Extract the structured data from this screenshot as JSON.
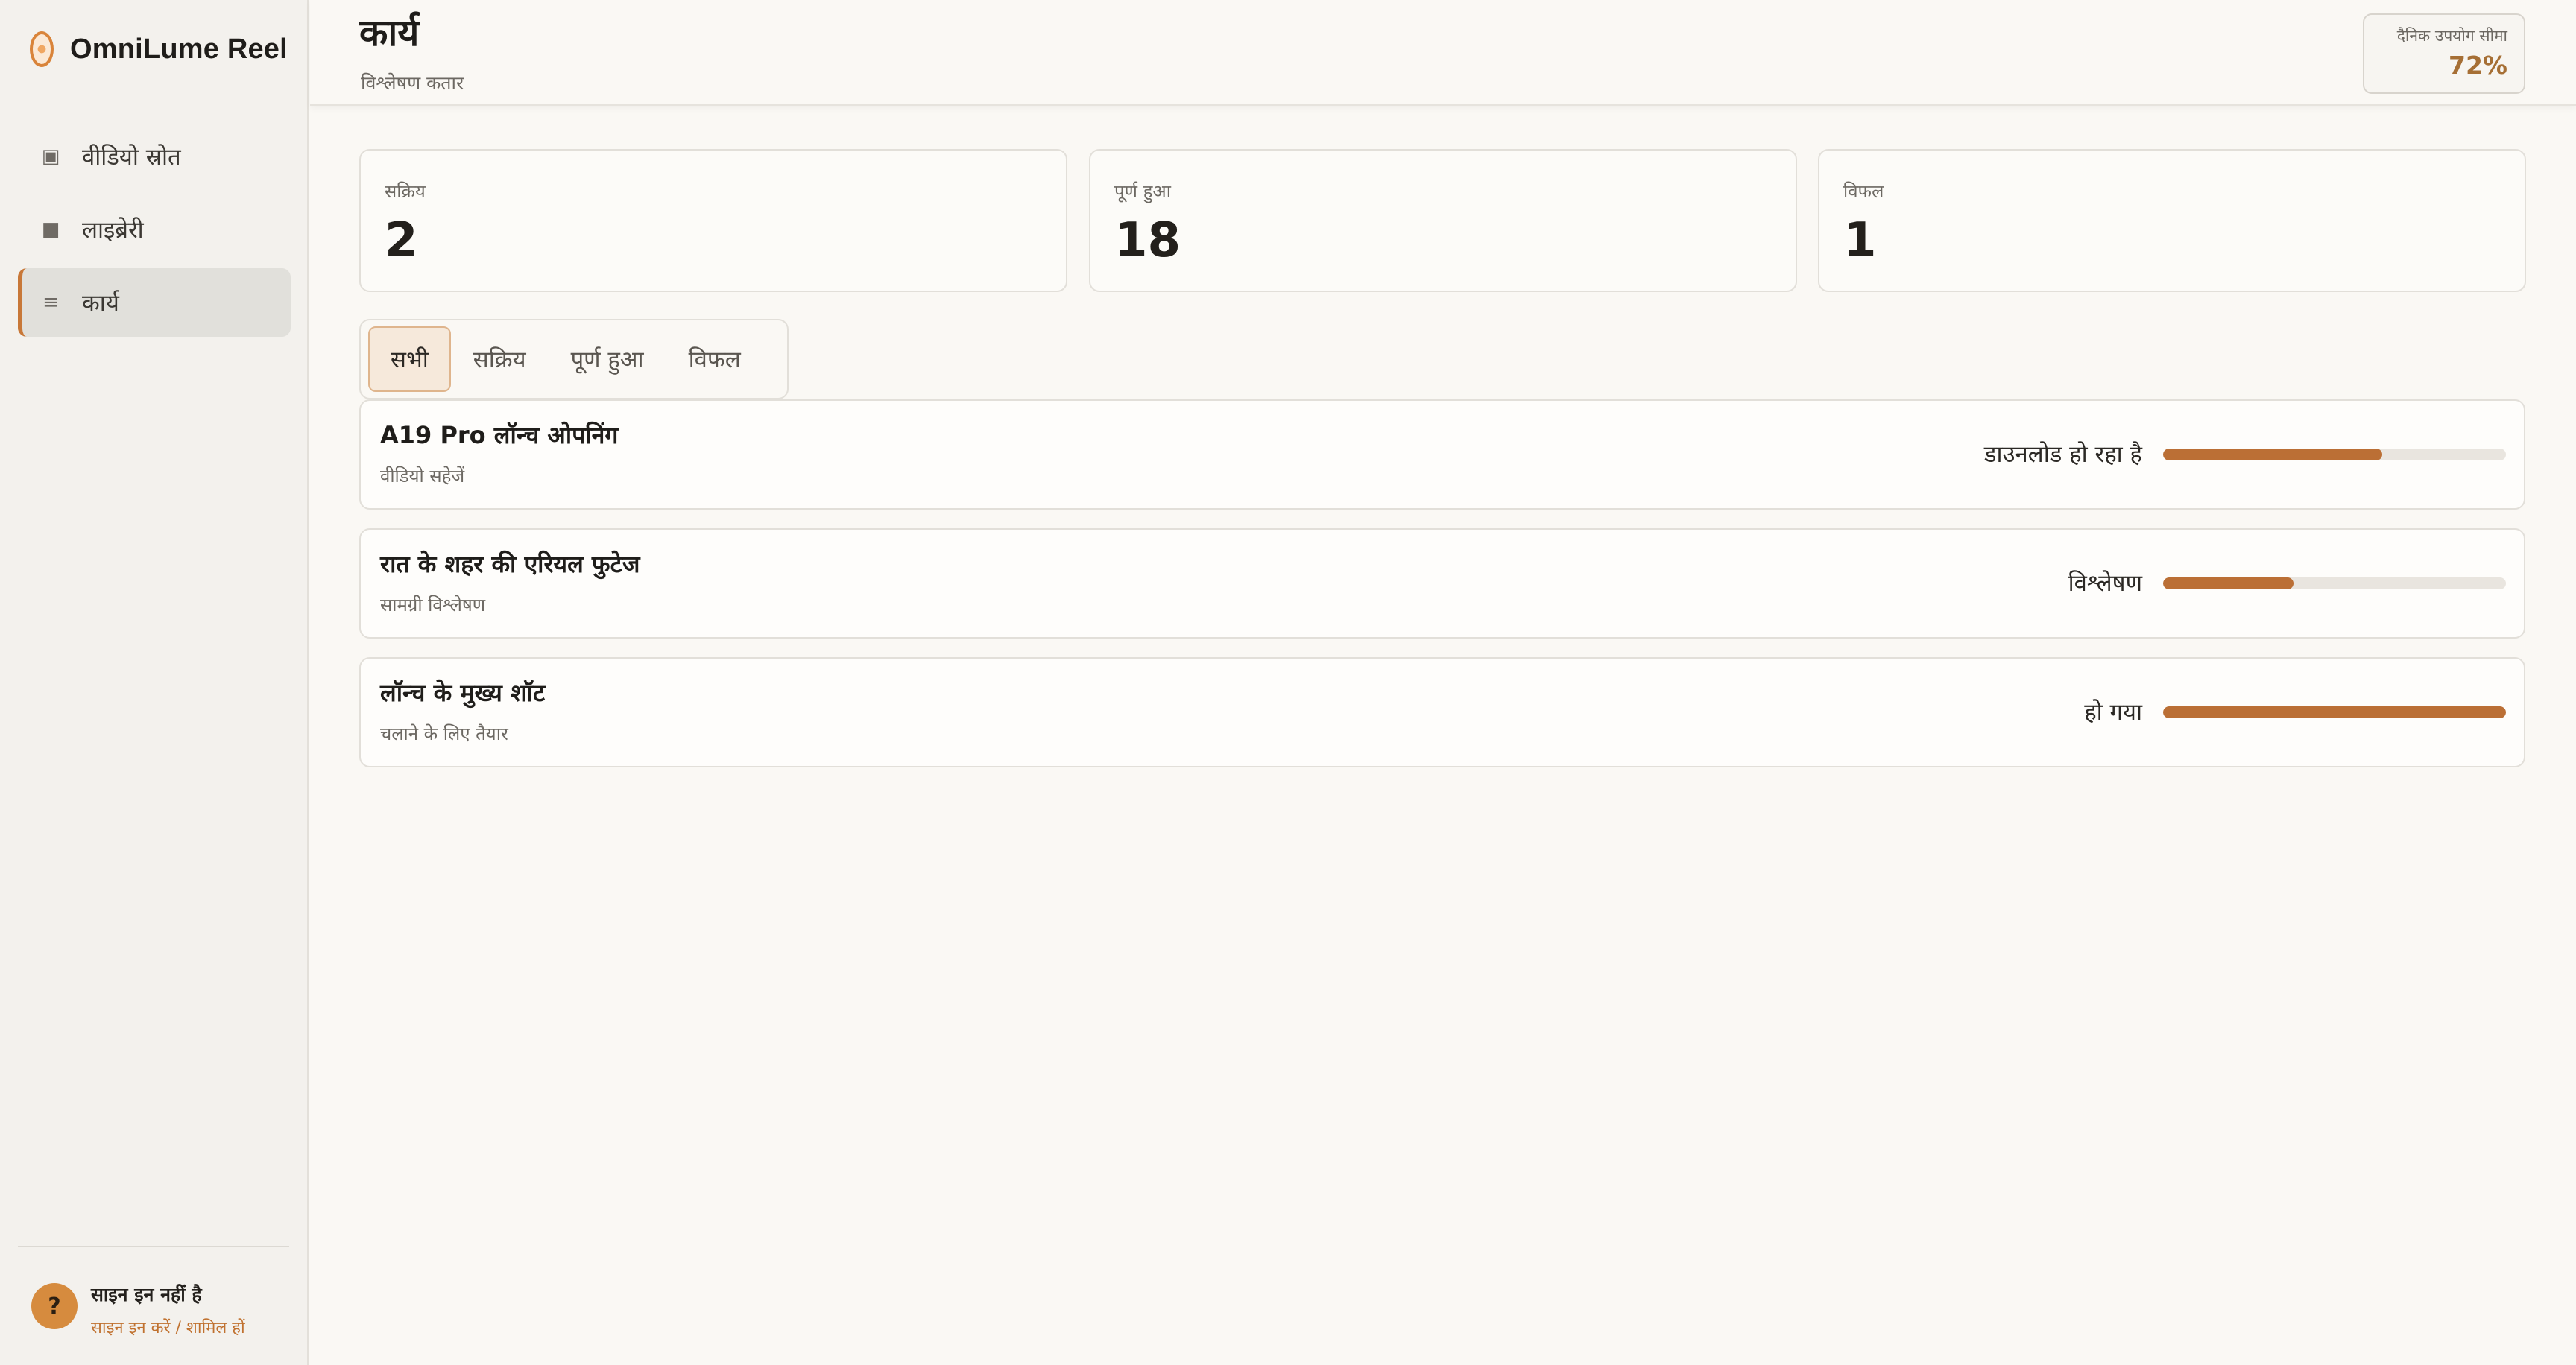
{
  "app": {
    "name": "OmniLume Reel"
  },
  "sidebar": {
    "items": [
      {
        "label": "वीडियो स्रोत",
        "icon": "video-source-icon",
        "glyph": "▣",
        "active": false
      },
      {
        "label": "लाइब्रेरी",
        "icon": "library-icon",
        "glyph": "■",
        "active": false
      },
      {
        "label": "कार्य",
        "icon": "tasks-icon",
        "glyph": "≡",
        "active": true
      }
    ],
    "user": {
      "avatar_glyph": "?",
      "title": "साइन इन नहीं है",
      "link": "साइन इन करें / शामिल हों"
    }
  },
  "header": {
    "title": "कार्य",
    "subtitle": "विश्लेषण कतार",
    "quota_label": "दैनिक उपयोग सीमा",
    "quota_value": "72%"
  },
  "stats": [
    {
      "label": "सक्रिय",
      "value": "2"
    },
    {
      "label": "पूर्ण हुआ",
      "value": "18"
    },
    {
      "label": "विफल",
      "value": "1"
    }
  ],
  "tabs": [
    {
      "label": "सभी",
      "active": true
    },
    {
      "label": "सक्रिय",
      "active": false
    },
    {
      "label": "पूर्ण हुआ",
      "active": false
    },
    {
      "label": "विफल",
      "active": false
    }
  ],
  "jobs": [
    {
      "title": "A19 Pro लॉन्च ओपनिंग",
      "subtitle": "वीडियो सहेजें",
      "status": "डाउनलोड हो रहा है",
      "progress": 64
    },
    {
      "title": "रात के शहर की एरियल फुटेज",
      "subtitle": "सामग्री विश्लेषण",
      "status": "विश्लेषण",
      "progress": 38
    },
    {
      "title": "लॉन्च के मुख्य शॉट",
      "subtitle": "चलाने के लिए तैयार",
      "status": "हो गया",
      "progress": 100
    }
  ],
  "colors": {
    "accent": "#bb6f35",
    "quota": "#a66f35",
    "link": "#c0712f"
  }
}
